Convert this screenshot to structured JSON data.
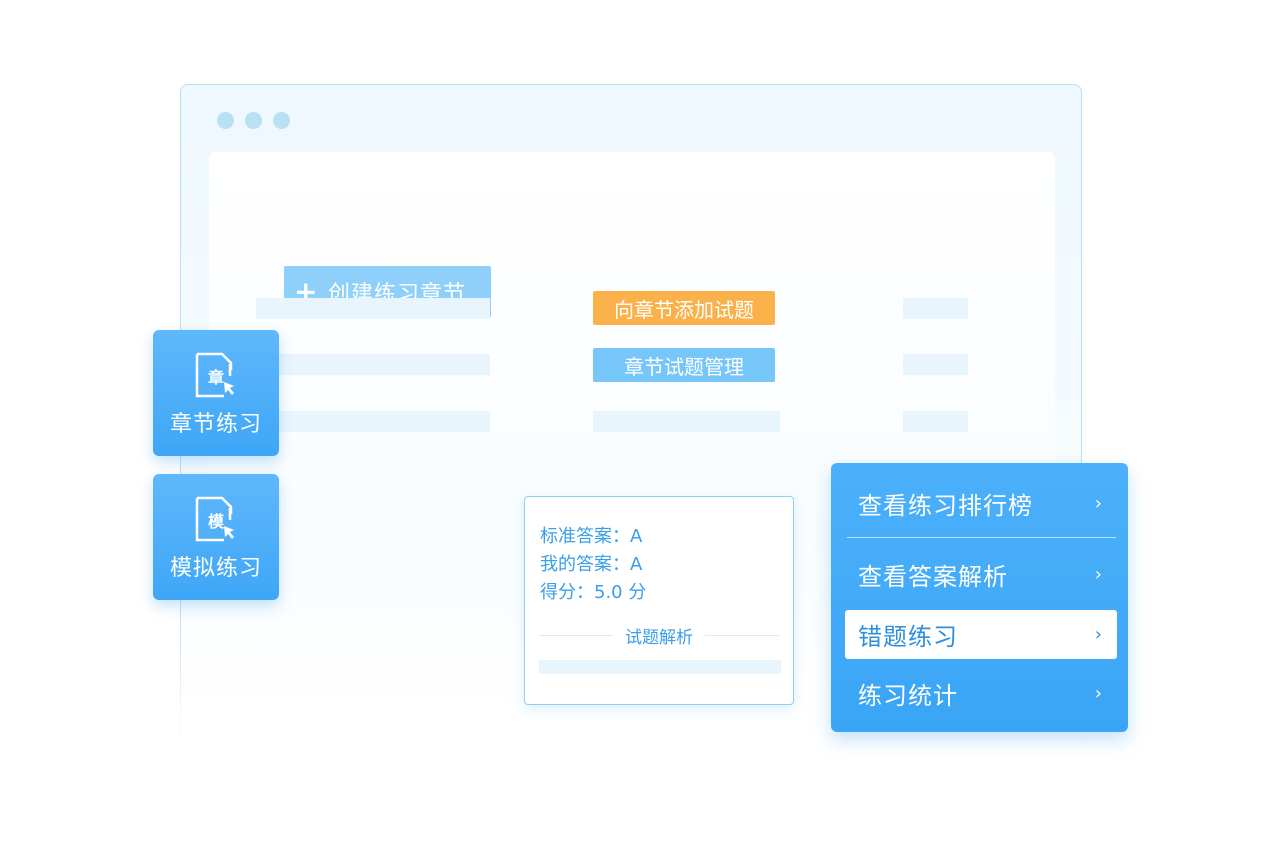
{
  "window": {
    "controls": [
      "dot",
      "dot",
      "dot"
    ]
  },
  "toolbar": {
    "create_label": "创建练习章节",
    "create_icon": "plus-icon"
  },
  "table_actions": {
    "add_questions_label": "向章节添加试题",
    "manage_questions_label": "章节试题管理"
  },
  "side_cards": [
    {
      "icon_char": "章",
      "label": "章节练习",
      "icon": "document-cursor-icon"
    },
    {
      "icon_char": "模",
      "label": "模拟练习",
      "icon": "document-cursor-icon"
    }
  ],
  "answer_card": {
    "standard_answer": "标准答案：A",
    "my_answer": "我的答案：A",
    "score": "得分：5.0 分",
    "analysis_title": "试题解析"
  },
  "menu": {
    "items": [
      {
        "label": "查看练习排行榜",
        "chevron": "›"
      },
      {
        "label": "查看答案解析",
        "chevron": "›"
      },
      {
        "label": "错题练习",
        "chevron": "›",
        "active": true
      },
      {
        "label": "练习统计",
        "chevron": "›"
      }
    ]
  },
  "colors": {
    "accent_blue": "#3ea6f7",
    "orange_tag": "#fbb14a",
    "light_blue_tag": "#76c6f9",
    "placeholder_bar": "#e9f5fd"
  }
}
